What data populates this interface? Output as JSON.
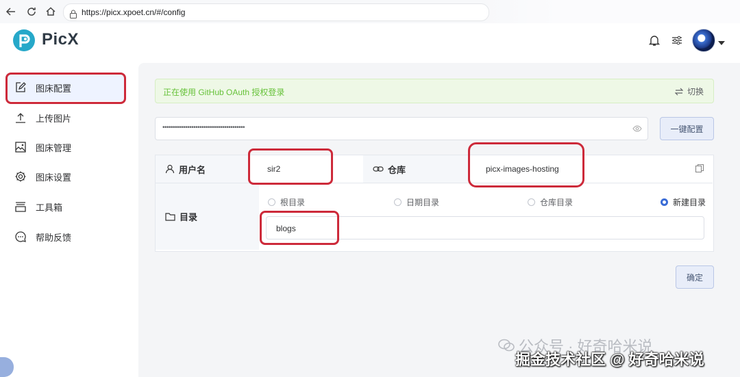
{
  "browser": {
    "url": "https://picx.xpoet.cn/#/config"
  },
  "app": {
    "name": "PicX"
  },
  "sidebar": {
    "items": [
      {
        "label": "图床配置",
        "icon": "edit-icon",
        "active": true
      },
      {
        "label": "上传图片",
        "icon": "upload-icon"
      },
      {
        "label": "图床管理",
        "icon": "image-icon"
      },
      {
        "label": "图床设置",
        "icon": "settings-icon"
      },
      {
        "label": "工具箱",
        "icon": "toolbox-icon"
      },
      {
        "label": "帮助反馈",
        "icon": "chat-icon"
      }
    ]
  },
  "notice": {
    "text": "正在使用 GitHub OAuth 授权登录",
    "switch_label": "切换"
  },
  "token": {
    "masked_value": "••••••••••••••••••••••••••••••••••••••••",
    "one_click_label": "一键配置"
  },
  "form": {
    "username_label": "用户名",
    "username_value": "sir2",
    "repo_label": "仓库",
    "repo_value": "picx-images-hosting",
    "dir_label": "目录",
    "dir_options": [
      {
        "label": "根目录",
        "checked": false
      },
      {
        "label": "日期目录",
        "checked": false
      },
      {
        "label": "仓库目录",
        "checked": false
      },
      {
        "label": "新建目录",
        "checked": true
      }
    ],
    "dir_value": "blogs",
    "confirm_label": "确定"
  },
  "watermark": {
    "line1": "公众号 · 好奇哈米说",
    "line2": "掘金技术社区 @ 好奇哈米说"
  },
  "colors": {
    "accent": "#3a6cd6",
    "highlight": "#cd2a3a",
    "success": "#67c23a"
  }
}
